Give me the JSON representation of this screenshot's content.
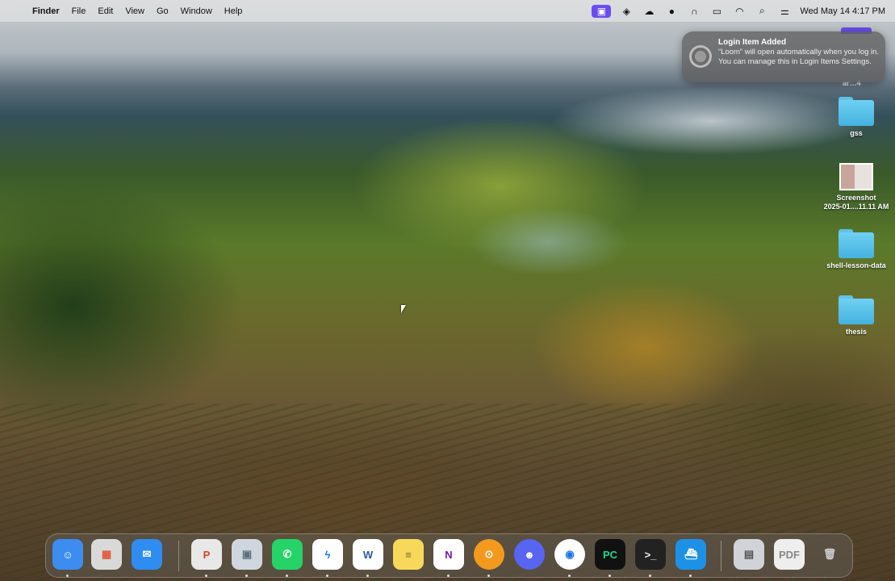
{
  "menubar": {
    "app_name": "Finder",
    "items": [
      "File",
      "Edit",
      "View",
      "Go",
      "Window",
      "Help"
    ],
    "clock": "Wed May 14  4:17 PM"
  },
  "notification": {
    "title": "Login Item Added",
    "body": "“Loom” will open automatically when you log in. You can manage this in Login Items Settings."
  },
  "desktop": {
    "partial_label": "ar…4",
    "items": [
      {
        "label": "gss",
        "kind": "folder"
      },
      {
        "label": "Screenshot\n2025-01....11.11 AM",
        "kind": "image"
      },
      {
        "label": "shell-lesson-data",
        "kind": "folder"
      },
      {
        "label": "thesis",
        "kind": "folder"
      }
    ]
  },
  "dock": {
    "apps": [
      {
        "name": "finder-icon",
        "glyph": "☺",
        "bg": "#3d8df0",
        "color": "#fff"
      },
      {
        "name": "launchpad-icon",
        "glyph": "▦",
        "bg": "#d9d9d9",
        "color": "#e0583a"
      },
      {
        "name": "mail-icon",
        "glyph": "✉",
        "bg": "#2f8cf0",
        "color": "#fff"
      },
      {
        "name": "powerpoint-icon",
        "glyph": "P",
        "bg": "#e8e8e8",
        "color": "#d24726"
      },
      {
        "name": "preview-icon",
        "glyph": "▣",
        "bg": "#cfd6dd",
        "color": "#5a7080"
      },
      {
        "name": "whatsapp-icon",
        "glyph": "✆",
        "bg": "#25d366",
        "color": "#fff"
      },
      {
        "name": "messenger-icon",
        "glyph": "ϟ",
        "bg": "#ffffff",
        "color": "#1877f2"
      },
      {
        "name": "word-icon",
        "glyph": "W",
        "bg": "#ffffff",
        "color": "#2b579a"
      },
      {
        "name": "notes-icon",
        "glyph": "≡",
        "bg": "#f8d85a",
        "color": "#7a6a30"
      },
      {
        "name": "onenote-icon",
        "glyph": "N",
        "bg": "#ffffff",
        "color": "#7719aa"
      },
      {
        "name": "openvpn-icon",
        "glyph": "⊙",
        "bg": "#f39a1e",
        "color": "#fff"
      },
      {
        "name": "discord-icon",
        "glyph": "☻",
        "bg": "#5865f2",
        "color": "#fff"
      },
      {
        "name": "chrome-icon",
        "glyph": "◉",
        "bg": "#ffffff",
        "color": "#1a73e8"
      },
      {
        "name": "pycharm-icon",
        "glyph": "PC",
        "bg": "#111111",
        "color": "#21d789"
      },
      {
        "name": "terminal-icon",
        "glyph": ">_",
        "bg": "#222222",
        "color": "#eee"
      },
      {
        "name": "docker-icon",
        "glyph": "⛴",
        "bg": "#1d91e6",
        "color": "#fff"
      },
      {
        "name": "downloads-stack-icon",
        "glyph": "▤",
        "bg": "#d0d4d8",
        "color": "#555"
      },
      {
        "name": "pdf-stack-icon",
        "glyph": "PDF",
        "bg": "#eeeeee",
        "color": "#888"
      },
      {
        "name": "trash-icon",
        "glyph": "🗑",
        "bg": "transparent",
        "color": "#ccc"
      }
    ]
  }
}
